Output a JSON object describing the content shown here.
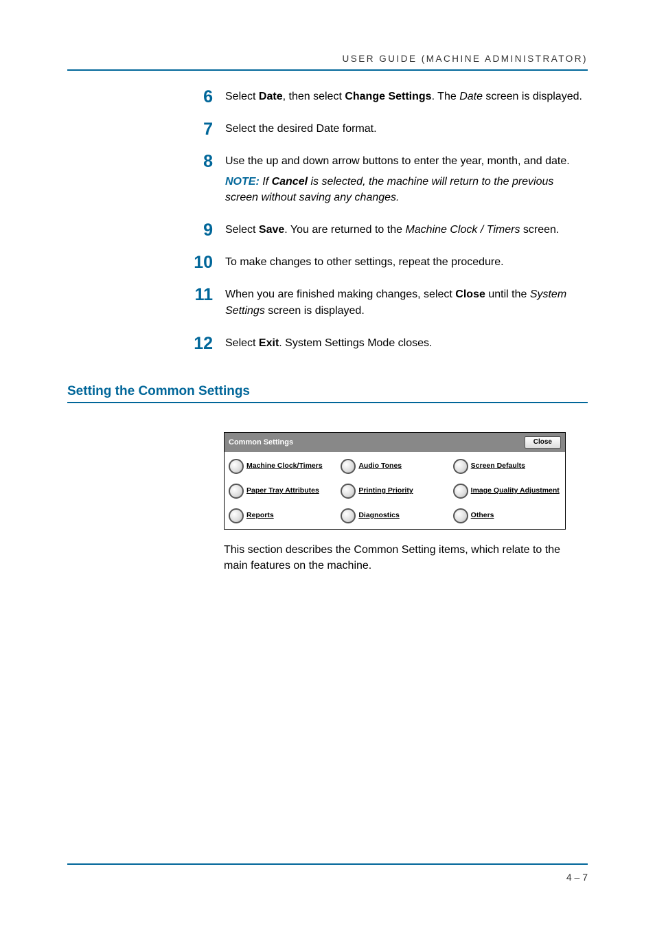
{
  "header": {
    "title": "USER GUIDE (MACHINE ADMINISTRATOR)"
  },
  "steps": [
    {
      "num": "6",
      "segments": [
        {
          "t": "Select "
        },
        {
          "t": "Date",
          "b": true
        },
        {
          "t": ", then select "
        },
        {
          "t": "Change Settings",
          "b": true
        },
        {
          "t": ". The "
        },
        {
          "t": "Date",
          "i": true
        },
        {
          "t": " screen is displayed."
        }
      ]
    },
    {
      "num": "7",
      "segments": [
        {
          "t": "Select the desired Date format."
        }
      ]
    },
    {
      "num": "8",
      "segments": [
        {
          "t": "Use the up and down arrow buttons to enter the year, month, and date."
        }
      ],
      "note": {
        "lead": "NOTE:",
        "segments": [
          {
            "t": " If "
          },
          {
            "t": "Cancel",
            "b": true
          },
          {
            "t": " is selected, the machine will return to the previous screen without saving any changes."
          }
        ]
      }
    },
    {
      "num": "9",
      "segments": [
        {
          "t": "Select "
        },
        {
          "t": "Save",
          "b": true
        },
        {
          "t": ". You are returned to the "
        },
        {
          "t": "Machine Clock / Timers",
          "i": true
        },
        {
          "t": " screen."
        }
      ]
    },
    {
      "num": "10",
      "segments": [
        {
          "t": "To make changes to other settings, repeat the procedure."
        }
      ]
    },
    {
      "num": "11",
      "segments": [
        {
          "t": "When you are finished making changes, select "
        },
        {
          "t": "Close",
          "b": true
        },
        {
          "t": " until the "
        },
        {
          "t": "System Settings",
          "i": true
        },
        {
          "t": " screen is displayed."
        }
      ]
    },
    {
      "num": "12",
      "segments": [
        {
          "t": "Select "
        },
        {
          "t": "Exit",
          "b": true
        },
        {
          "t": ". System Settings Mode closes."
        }
      ]
    }
  ],
  "section": {
    "heading": "Setting the Common Settings"
  },
  "ui": {
    "panel_title": "Common Settings",
    "close_label": "Close",
    "options": [
      {
        "label": "Machine Clock/Timers"
      },
      {
        "label": "Audio Tones"
      },
      {
        "label": "Screen Defaults"
      },
      {
        "label": "Paper Tray Attributes"
      },
      {
        "label": "Printing Priority"
      },
      {
        "label": "Image Quality Adjustment"
      },
      {
        "label": "Reports"
      },
      {
        "label": "Diagnostics"
      },
      {
        "label": "Others"
      }
    ]
  },
  "description": "This section describes the Common Setting items, which relate to the main features on the machine.",
  "footer": {
    "page": "4 – 7"
  }
}
